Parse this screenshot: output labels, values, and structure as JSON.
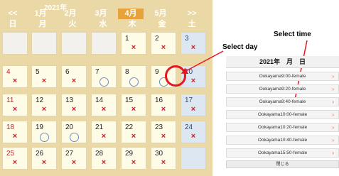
{
  "calendar": {
    "year": "2021年",
    "nav": [
      "<<",
      "1月",
      "2月",
      "3月",
      "4月",
      "5月",
      ">>"
    ],
    "weekdays": [
      "日",
      "月",
      "火",
      "水",
      "木",
      "金",
      "土"
    ],
    "weeks": [
      [
        {
          "d": ""
        },
        {
          "d": ""
        },
        {
          "d": ""
        },
        {
          "d": ""
        },
        {
          "d": "1",
          "m": "x"
        },
        {
          "d": "2",
          "m": "x"
        },
        {
          "d": "3",
          "m": "x"
        }
      ],
      [
        {
          "d": "4",
          "m": "x"
        },
        {
          "d": "5",
          "m": "x"
        },
        {
          "d": "6",
          "m": "x"
        },
        {
          "d": "7",
          "m": "o"
        },
        {
          "d": "8",
          "m": "o"
        },
        {
          "d": "9",
          "m": "o"
        },
        {
          "d": "10",
          "m": "x"
        }
      ],
      [
        {
          "d": "11",
          "m": "x"
        },
        {
          "d": "12",
          "m": "x"
        },
        {
          "d": "13",
          "m": "x"
        },
        {
          "d": "14",
          "m": "x"
        },
        {
          "d": "15",
          "m": "x"
        },
        {
          "d": "16",
          "m": "x"
        },
        {
          "d": "17",
          "m": "x"
        }
      ],
      [
        {
          "d": "18",
          "m": "x"
        },
        {
          "d": "19",
          "m": "o"
        },
        {
          "d": "20",
          "m": "o"
        },
        {
          "d": "21",
          "m": "x"
        },
        {
          "d": "22",
          "m": "x"
        },
        {
          "d": "23",
          "m": "x"
        },
        {
          "d": "24",
          "m": "x"
        }
      ],
      [
        {
          "d": "25",
          "m": "x"
        },
        {
          "d": "26",
          "m": "x"
        },
        {
          "d": "27",
          "m": "x"
        },
        {
          "d": "28",
          "m": "x"
        },
        {
          "d": "29",
          "m": "x"
        },
        {
          "d": "30",
          "m": "x"
        },
        {
          "d": ""
        }
      ]
    ]
  },
  "annotations": {
    "select_day": "Select day",
    "select_time": "Select time"
  },
  "panel": {
    "header": "2021年　月　日",
    "slots": [
      "Ookayama9:00-female",
      "Ookayama9:20-female",
      "Ookayama9:40-female",
      "Ookayama10:00-female",
      "Ookayama10:20-female",
      "Ookayama10:40-female",
      "Ookayama15:50-female"
    ],
    "close_label": "閉じる"
  },
  "colors": {
    "calendar_bg": "#ead8a6",
    "active_month": "#e8a23a",
    "cross": "#d01e26",
    "circle": "#6e8fc2",
    "highlight_ring": "#e5171f"
  }
}
